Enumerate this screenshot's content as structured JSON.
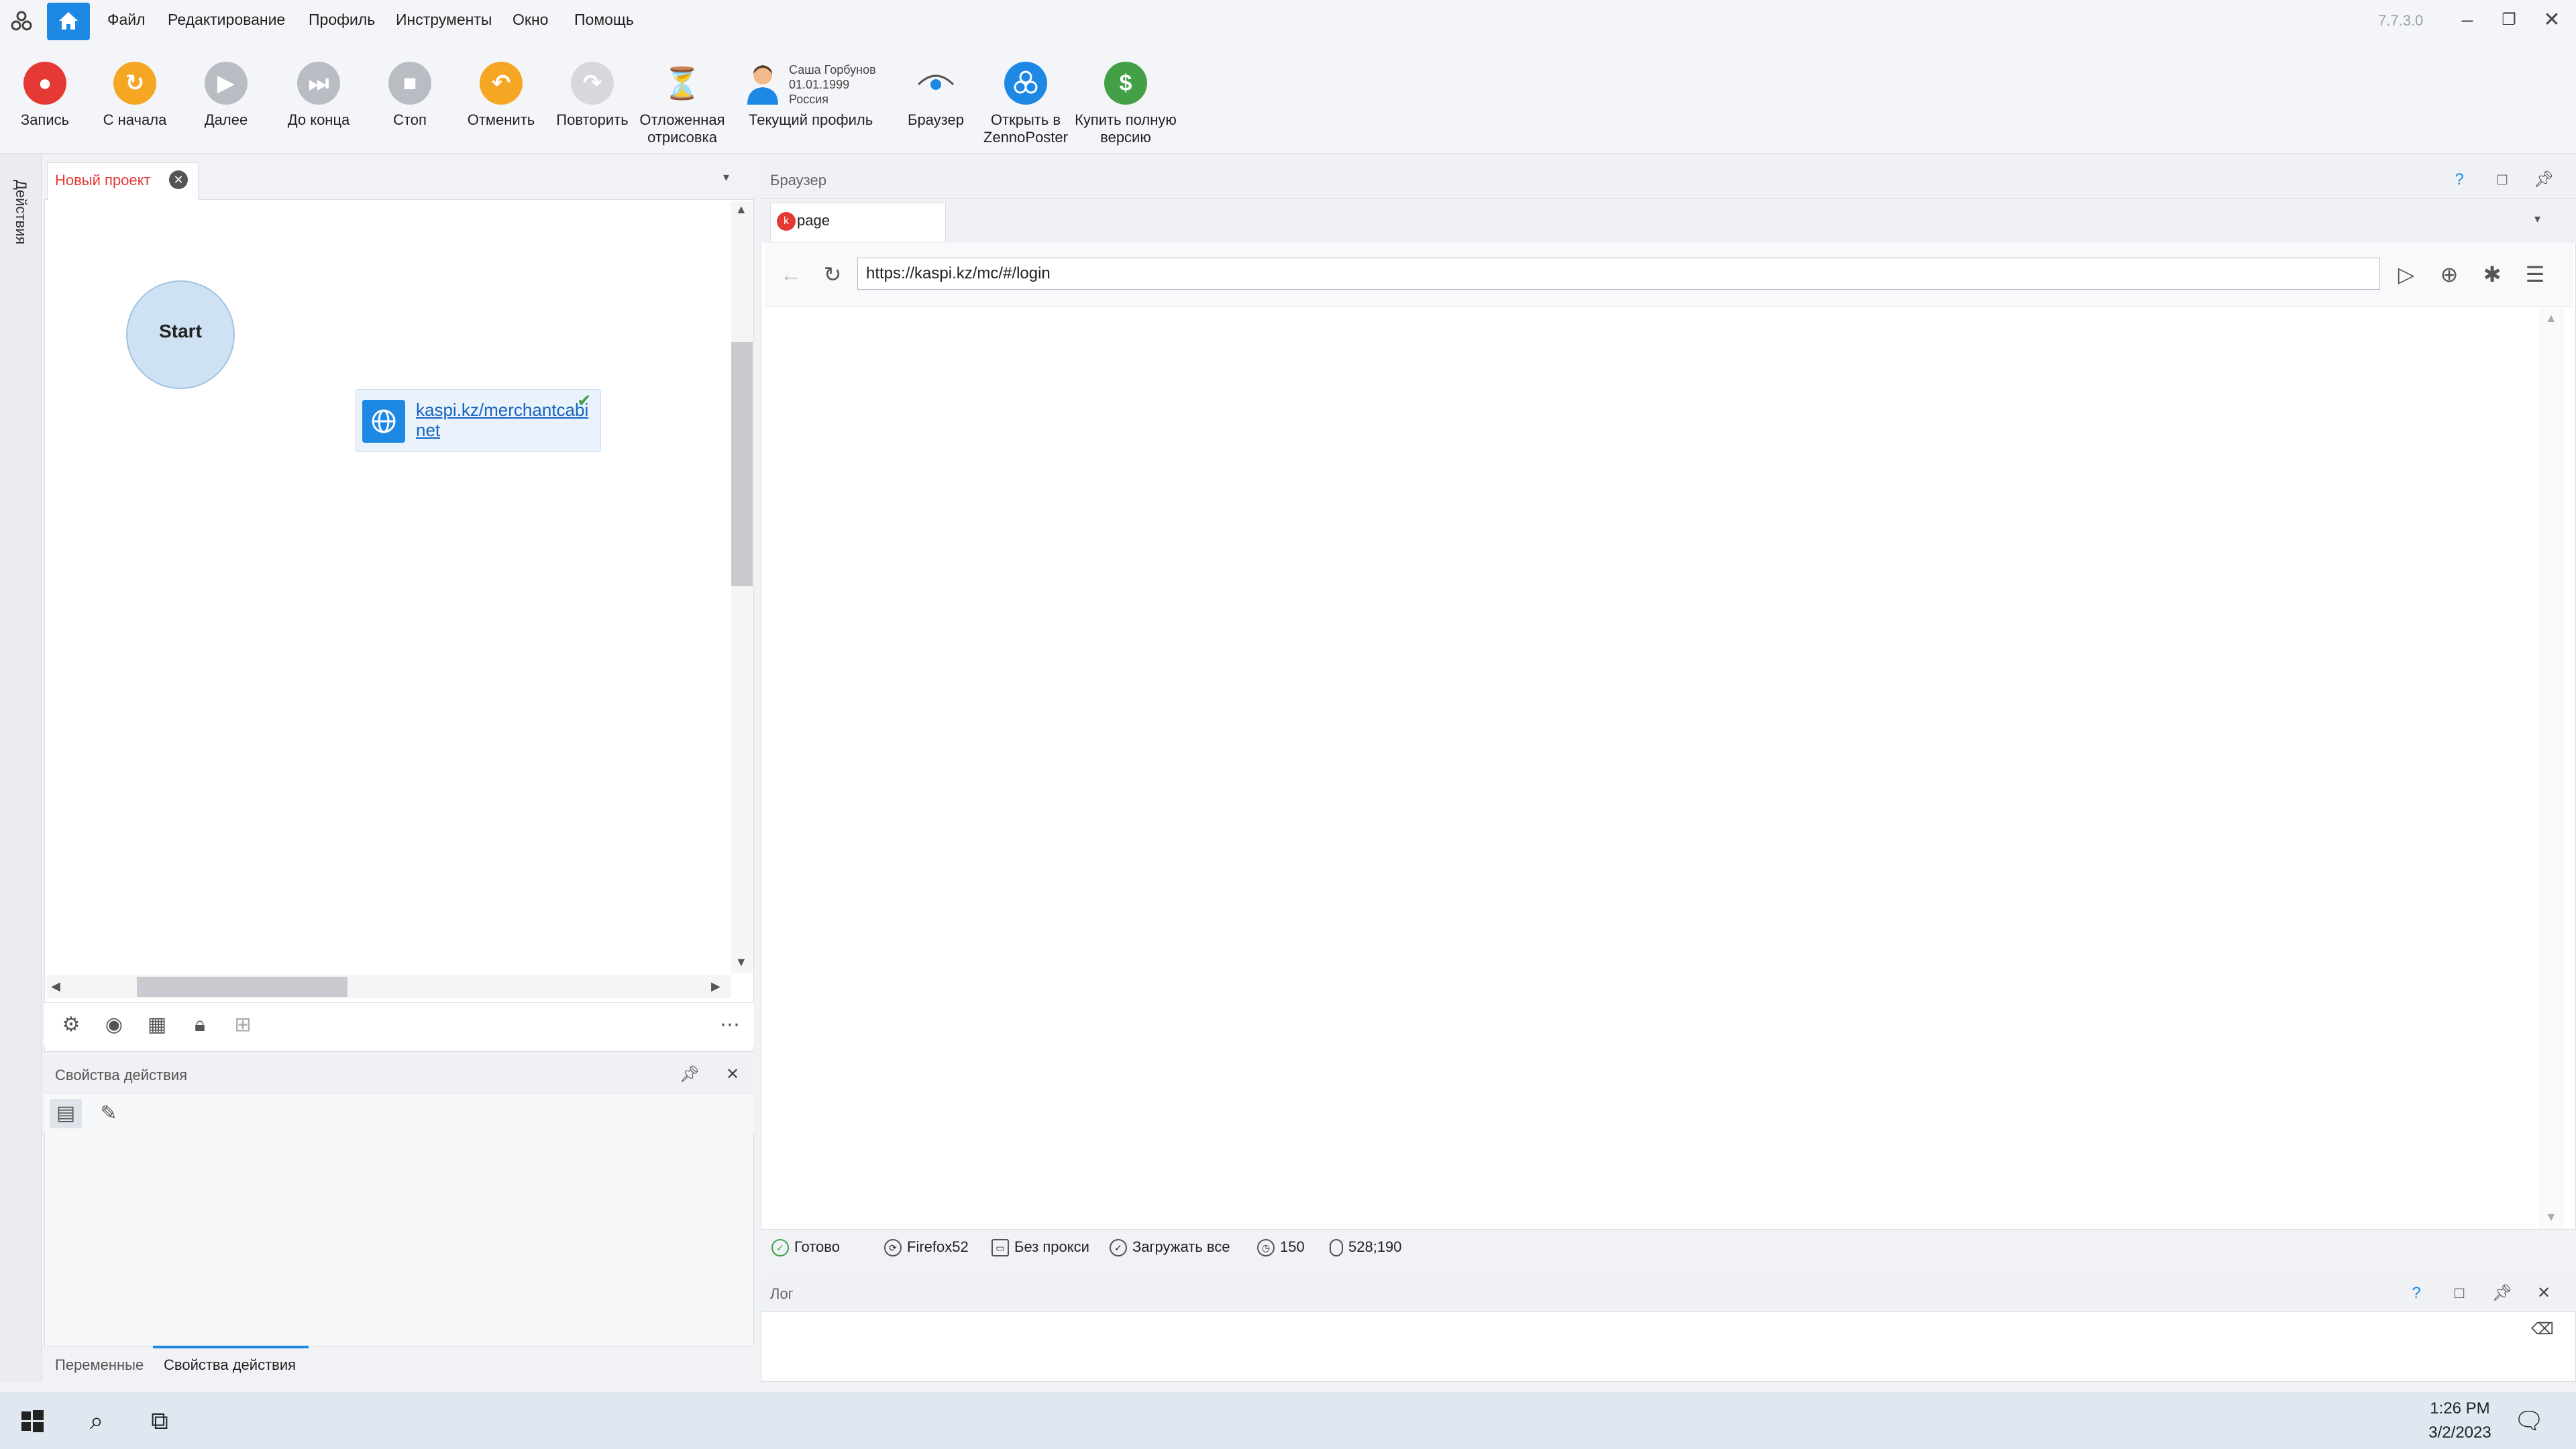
{
  "menu": {
    "items": [
      "Файл",
      "Редактирование",
      "Профиль",
      "Инструменты",
      "Окно",
      "Помощь"
    ],
    "version": "7.7.3.0"
  },
  "toolbar": {
    "record": "Запись",
    "restart": "С начала",
    "next": "Далее",
    "to_end": "До конца",
    "stop": "Стоп",
    "undo": "Отменить",
    "redo": "Повторить",
    "deferred_render": "Отложенная отрисовка",
    "profile_name": "Саша Горбунов",
    "profile_birth": "01.01.1999",
    "profile_country": "Россия",
    "current_profile": "Текущий профиль",
    "browser": "Браузер",
    "open_in": "Открыть в ZennoPoster",
    "buy": "Купить полную версию",
    "colors": {
      "record": "#e53935",
      "restart": "#f5a623",
      "undo": "#f5a623",
      "disabled": "#b9bcc3",
      "zenno": "#1e88e5",
      "buy": "#43a047"
    }
  },
  "sidebar": {
    "label": "Действия"
  },
  "project": {
    "tab_label": "Новый проект",
    "start_label": "Start",
    "action_link": "kaspi.kz/merchantcabinet"
  },
  "props": {
    "title": "Свойства действия",
    "tabs": [
      "Переменные",
      "Свойства действия"
    ]
  },
  "browser": {
    "panel_title": "Браузер",
    "tab_label": "page",
    "url": "https://kaspi.kz/mc/#/login",
    "status": {
      "ready": "Готово",
      "engine": "Firefox52",
      "proxy": "Без прокси",
      "load": "Загружать все",
      "timeout": "150",
      "cursor": "528;190"
    }
  },
  "log": {
    "title": "Лог"
  },
  "taskbar": {
    "time": "1:26 PM",
    "date": "3/2/2023"
  }
}
